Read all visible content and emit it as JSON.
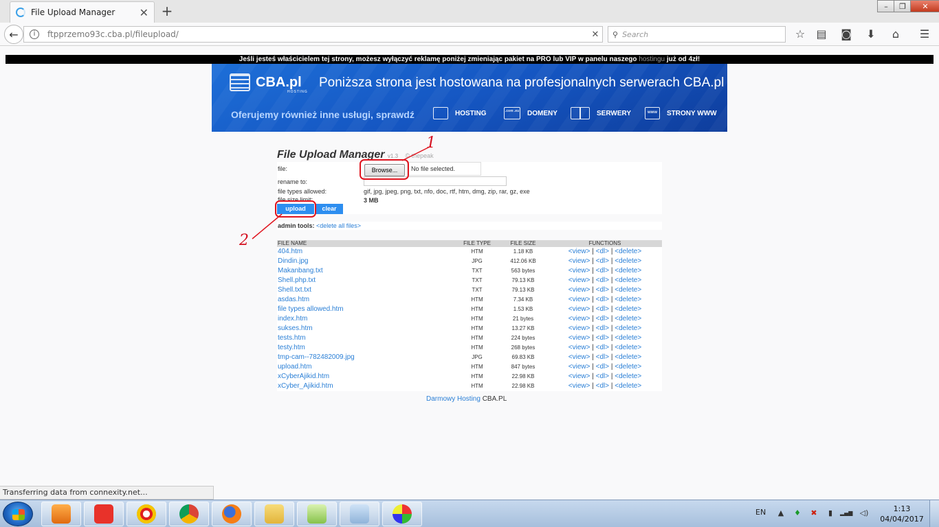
{
  "browser": {
    "tab_title": "File Upload Manager",
    "tab_close": "✕",
    "new_tab": "+",
    "url": "ftpprzemo93c.cba.pl/fileupload/",
    "url_clear": "✕",
    "search_placeholder": "Search",
    "window_controls": [
      "–",
      "❐",
      "✕"
    ]
  },
  "banner": {
    "text_pre": "Jeśli jesteś właścicielem tej strony, możesz wyłączyć reklamę poniżej zmieniając pakiet na PRO lub VIP w panelu naszego ",
    "highlight": "hostingu",
    "text_post": " już od 4zł!"
  },
  "cba": {
    "logo_text": "CBA.pl",
    "logo_sub": "HOSTING",
    "headline": "Poniższa strona jest hostowana na profesjonalnych serwerach CBA.pl",
    "offer": "Oferujemy również inne usługi, sprawdź",
    "nav": [
      "HOSTING",
      "DOMENY",
      "SERWERY",
      "STRONY WWW"
    ],
    "nav_icon_text": [
      ".com .eu",
      "www"
    ]
  },
  "fum": {
    "title": "File Upload Manager",
    "version": "v1.3",
    "by": "© thepeak",
    "file_label": "file:",
    "browse_label": "Browse...",
    "no_file": "No file selected.",
    "rename_label": "rename to:",
    "types_label": "file types allowed:",
    "types_value": "gif, jpg, jpeg, png, txt, nfo, doc, rtf, htm, dmg, zip, rar, gz, exe",
    "size_label": "file size limit:",
    "size_value": "3 MB",
    "upload_label": "upload",
    "clear_label": "clear",
    "admin_label": "admin tools:",
    "admin_link": "<delete all files>",
    "columns": [
      "FILE NAME",
      "FILE TYPE",
      "FILE SIZE",
      "FUNCTIONS"
    ],
    "files": [
      {
        "name": "404.htm",
        "type": "HTM",
        "size": "1.18 KB"
      },
      {
        "name": "Dindin.jpg",
        "type": "JPG",
        "size": "412.06 KB"
      },
      {
        "name": "Makanbang.txt",
        "type": "TXT",
        "size": "563 bytes"
      },
      {
        "name": "Shell.php.txt",
        "type": "TXT",
        "size": "79.13 KB"
      },
      {
        "name": "Shell.txt.txt",
        "type": "TXT",
        "size": "79.13 KB"
      },
      {
        "name": "asdas.htm",
        "type": "HTM",
        "size": "7.34 KB"
      },
      {
        "name": "file types allowed.htm",
        "type": "HTM",
        "size": "1.53 KB"
      },
      {
        "name": "index.htm",
        "type": "HTM",
        "size": "21 bytes"
      },
      {
        "name": "sukses.htm",
        "type": "HTM",
        "size": "13.27 KB"
      },
      {
        "name": "tests.htm",
        "type": "HTM",
        "size": "224 bytes"
      },
      {
        "name": "testy.htm",
        "type": "HTM",
        "size": "268 bytes"
      },
      {
        "name": "tmp-cam--782482009.jpg",
        "type": "JPG",
        "size": "69.83 KB"
      },
      {
        "name": "upload.htm",
        "type": "HTM",
        "size": "847 bytes"
      },
      {
        "name": "xCyberAjikid.htm",
        "type": "HTM",
        "size": "22.98 KB"
      },
      {
        "name": "xCyber_Ajikid.htm",
        "type": "HTM",
        "size": "22.98 KB"
      }
    ],
    "func_view": "<view>",
    "func_dl": "<dl>",
    "func_delete": "<delete>",
    "func_sep": " | "
  },
  "annotations": {
    "one": "1",
    "two": "2"
  },
  "footer": {
    "link": "Darmowy Hosting",
    "suffix": " CBA.PL"
  },
  "status": "Transferring data from connexity.net...",
  "taskbar": {
    "lang": "EN",
    "time": "1:13",
    "date": "04/04/2017",
    "tray_icons": [
      "▲",
      "♦",
      "✖",
      "▮",
      "▂▄▆",
      "◁)"
    ]
  },
  "colors": {
    "link": "#2a7fd6",
    "button": "#2d8ef0",
    "annotation": "#e0141e",
    "cba_blue": "#1556c2"
  }
}
